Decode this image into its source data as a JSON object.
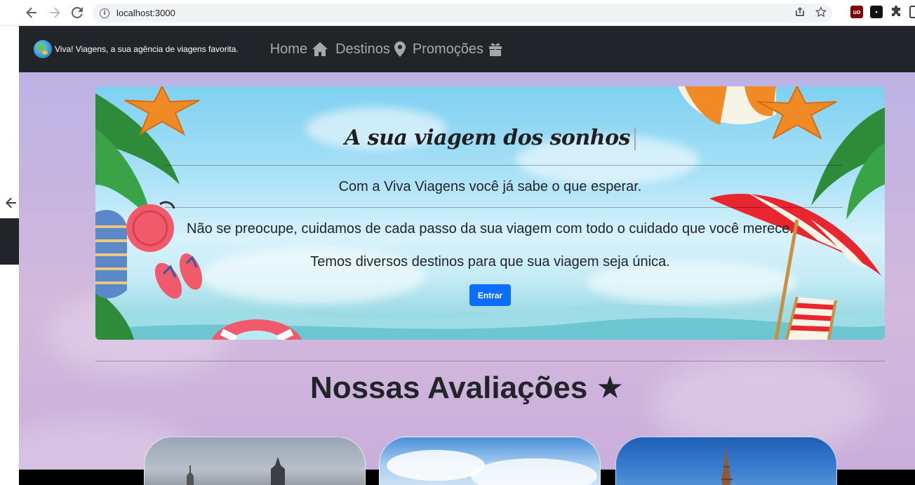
{
  "browser": {
    "url": "localhost:3000"
  },
  "navbar": {
    "brand_text": "Viva! Viagens, a sua agência de viagens favorita.",
    "items": [
      {
        "label": "Home",
        "icon": "home-icon"
      },
      {
        "label": "Destinos",
        "icon": "location-pin-icon"
      },
      {
        "label": "Promoções",
        "icon": "gift-icon"
      }
    ]
  },
  "hero": {
    "title": "A sua viagem dos sonhos",
    "lead": "Com a Viva Viagens você já sabe o que esperar.",
    "paragraph1": "Não se preocupe, cuidamos de cada passo da sua viagem com todo o cuidado que você merece.",
    "paragraph2": "Temos diversos destinos para que sua viagem seja única.",
    "button_label": "Entrar"
  },
  "reviews": {
    "title": "Nossas Avaliações",
    "star": "★"
  },
  "colors": {
    "navbar_bg": "#212529",
    "primary_button": "#0d6efd"
  }
}
